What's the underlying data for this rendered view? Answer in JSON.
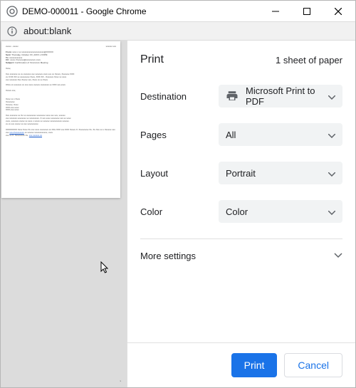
{
  "window": {
    "title": "DEMO-000011 - Google Chrome"
  },
  "addressbar": {
    "url": "about:blank"
  },
  "print": {
    "header": "Print",
    "sheets": "1 sheet of paper",
    "destination_label": "Destination",
    "destination_value": "Microsoft Print to PDF",
    "pages_label": "Pages",
    "pages_value": "All",
    "layout_label": "Layout",
    "layout_value": "Portrait",
    "color_label": "Color",
    "color_value": "Color",
    "more_label": "More settings",
    "print_btn": "Print",
    "cancel_btn": "Cancel"
  }
}
